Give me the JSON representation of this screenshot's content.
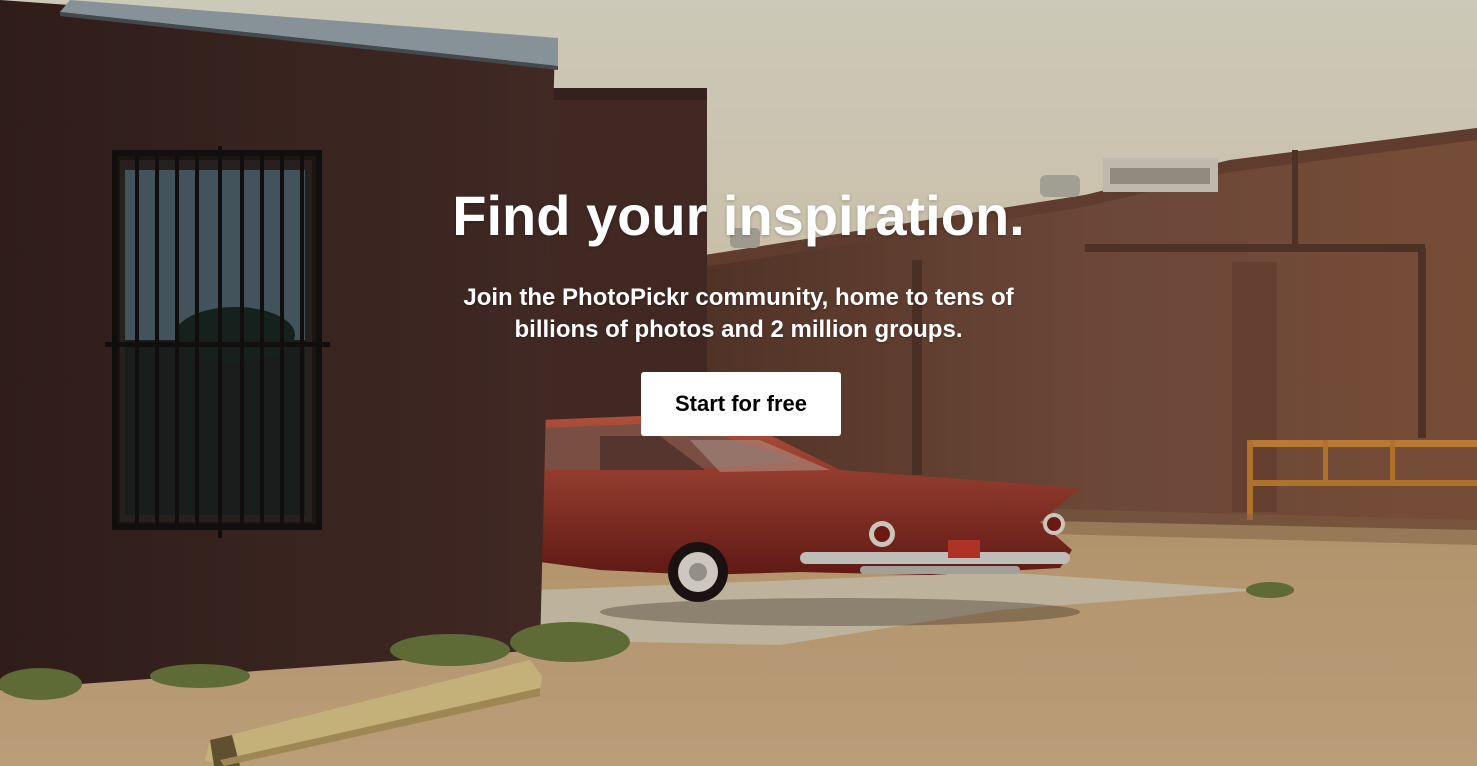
{
  "hero": {
    "headline": "Find your inspiration.",
    "subheadline": "Join the PhotoPickr community, home to tens of billions of photos and 2 million groups.",
    "cta_label": "Start for free"
  },
  "colors": {
    "sky": "#ebe6d4",
    "wall_dark": "#3e2722",
    "wall_tan": "#7a4d38",
    "ground": "#cfae80",
    "car_red": "#9a3026",
    "button_bg": "#ffffff",
    "button_text": "#000000",
    "text": "#ffffff"
  }
}
